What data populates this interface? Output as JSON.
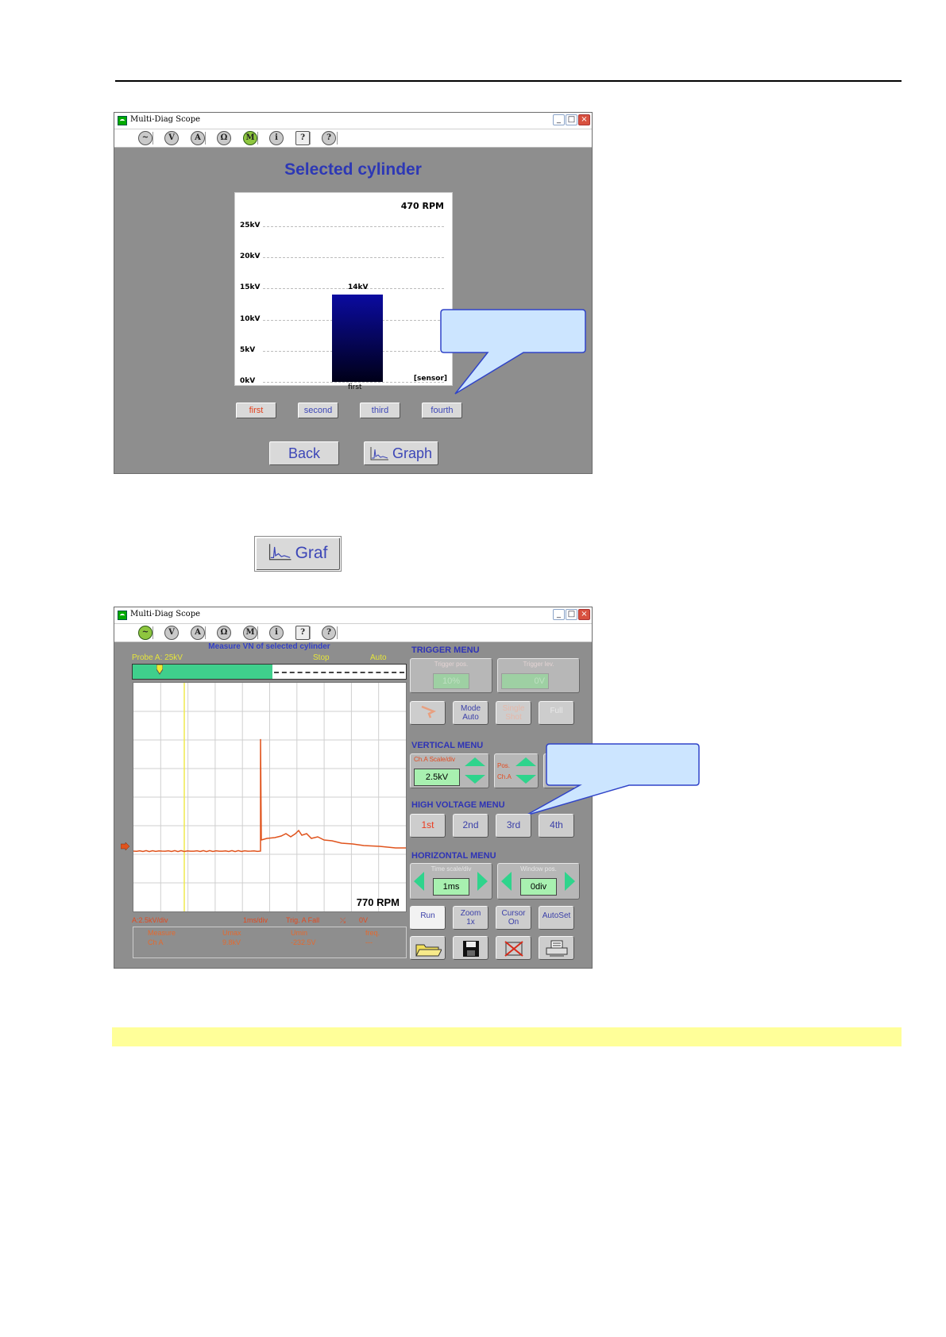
{
  "window1": {
    "title": "Multi-Diag Scope",
    "heading": "Selected cylinder",
    "toolbar_icons": [
      "sine-icon",
      "voltage-icon",
      "ampere-icon",
      "ohm-icon",
      "multi-icon",
      "info-icon",
      "help-file-icon",
      "help-icon"
    ],
    "toolbar_letters": [
      "~",
      "V",
      "A",
      "Ω",
      "M",
      "i",
      "?",
      "?"
    ],
    "active_icon": "multi-icon",
    "cylinder_buttons": [
      "first",
      "second",
      "third",
      "fourth"
    ],
    "active_cylinder": "first",
    "back_label": "Back",
    "graph_label": "Graph"
  },
  "chart_data": {
    "type": "bar",
    "title": "",
    "rpm": "470 RPM",
    "y_ticks": [
      "0kV",
      "5kV",
      "10kV",
      "15kV",
      "20kV",
      "25kV"
    ],
    "ylim": [
      0,
      25
    ],
    "categories": [
      "first"
    ],
    "values": [
      14
    ],
    "value_labels": [
      "14kV"
    ],
    "xlabel": "[sensor]",
    "grid": true,
    "bar_color": "#0b0ba0"
  },
  "graf_button": {
    "label": "Graf"
  },
  "window2": {
    "title": "Multi-Diag Scope",
    "measure_title": "Measure VN of selected cylinder",
    "probe": "Probe   A: 25kV",
    "stop": "Stop",
    "auto": "Auto",
    "rpm": "770  RPM",
    "status": {
      "scale": "A:2.5kV/div",
      "time": "1ms/div",
      "trig": "Trig.  A   Fall",
      "level": "0V"
    },
    "measure_table": {
      "headers": [
        "Measure",
        "Umax",
        "Umin",
        "freq."
      ],
      "row": [
        "Ch A",
        "9.8kV",
        "-232.5V",
        "---"
      ]
    },
    "trigger_menu": {
      "title": "TRIGGER MENU",
      "trigger_pos_label": "Trigger pos.",
      "trigger_pos_value": "10%",
      "trigger_level_label": "Trigger lev.",
      "trigger_level_value": "0V",
      "mode_label": "Mode Auto",
      "single_label": "Single Shot",
      "full_label": "Full"
    },
    "vertical_menu": {
      "title": "VERTICAL MENU",
      "scale_label": "Ch.A Scale/div",
      "scale_value": "2.5kV",
      "pos_label": "Pos.",
      "pos_channel": "Ch.A"
    },
    "hv_menu": {
      "title": "HIGH VOLTAGE MENU",
      "buttons": [
        "1st",
        "2nd",
        "3rd",
        "4th"
      ],
      "active": "1st"
    },
    "horizontal_menu": {
      "title": "HORIZONTAL MENU",
      "time_label": "Time scale/div",
      "time_value": "1ms",
      "window_label": "Window pos.",
      "window_value": "0div"
    },
    "bottom_buttons": {
      "run": "Run",
      "zoom_line1": "Zoom",
      "zoom_line2": "1x",
      "cursor_line1": "Cursor",
      "cursor_line2": "On",
      "autoset": "AutoSet"
    },
    "signal": {
      "baseline_div": 0,
      "spike_peak_kv": 9.8,
      "trace_color": "#e0531c"
    }
  },
  "colors": {
    "accent_text": "#2d38b5",
    "highlight_red": "#e3401c",
    "window_bg": "#8e8e8e",
    "callout_fill": "#cce5ff",
    "callout_stroke": "#3044c8"
  }
}
